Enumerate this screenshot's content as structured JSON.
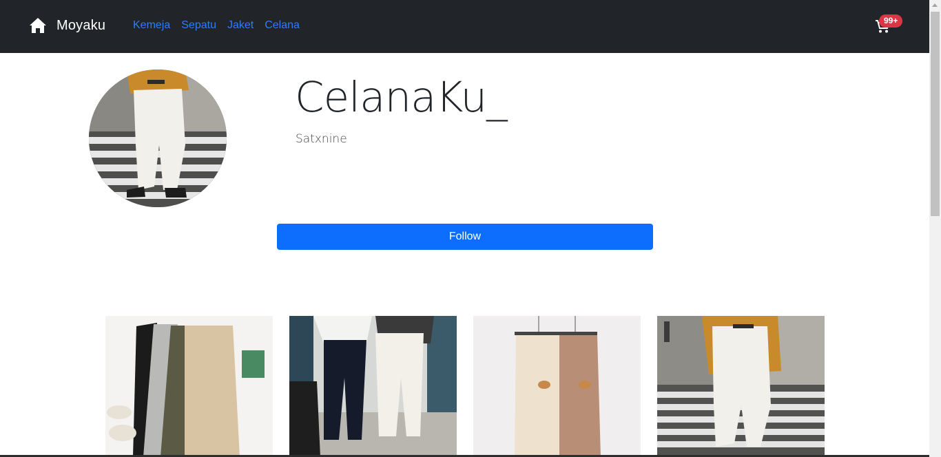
{
  "navbar": {
    "brand": "Moyaku",
    "brand_icon": "home-icon",
    "links": [
      "Kemeja",
      "Sepatu",
      "Jaket",
      "Celana"
    ],
    "cart_icon": "cart-icon",
    "cart_badge": "99+"
  },
  "profile": {
    "name": "CelanaKu_",
    "subtitle": "Satxnine",
    "follow_label": "Follow"
  },
  "products": [
    {
      "name": "product-image-1"
    },
    {
      "name": "product-image-2"
    },
    {
      "name": "product-image-3"
    },
    {
      "name": "product-image-4"
    }
  ],
  "colors": {
    "navbar_bg": "#212529",
    "link": "#2f7cf6",
    "primary": "#0d6efd",
    "badge": "#dc3545"
  }
}
